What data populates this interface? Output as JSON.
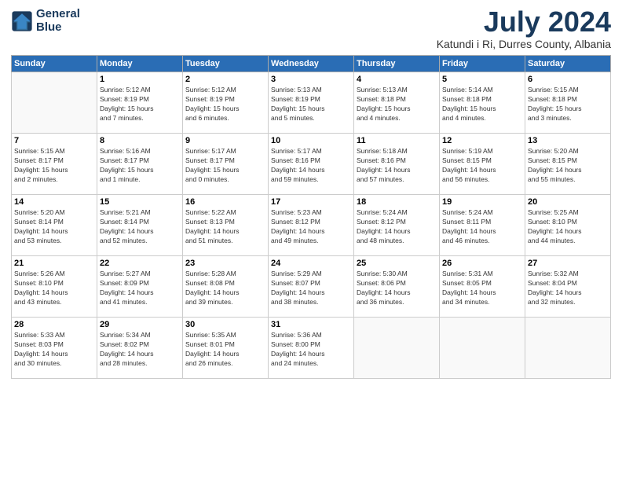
{
  "header": {
    "logo_line1": "General",
    "logo_line2": "Blue",
    "month": "July 2024",
    "location": "Katundi i Ri, Durres County, Albania"
  },
  "weekdays": [
    "Sunday",
    "Monday",
    "Tuesday",
    "Wednesday",
    "Thursday",
    "Friday",
    "Saturday"
  ],
  "weeks": [
    [
      {
        "day": "",
        "info": ""
      },
      {
        "day": "1",
        "info": "Sunrise: 5:12 AM\nSunset: 8:19 PM\nDaylight: 15 hours\nand 7 minutes."
      },
      {
        "day": "2",
        "info": "Sunrise: 5:12 AM\nSunset: 8:19 PM\nDaylight: 15 hours\nand 6 minutes."
      },
      {
        "day": "3",
        "info": "Sunrise: 5:13 AM\nSunset: 8:19 PM\nDaylight: 15 hours\nand 5 minutes."
      },
      {
        "day": "4",
        "info": "Sunrise: 5:13 AM\nSunset: 8:18 PM\nDaylight: 15 hours\nand 4 minutes."
      },
      {
        "day": "5",
        "info": "Sunrise: 5:14 AM\nSunset: 8:18 PM\nDaylight: 15 hours\nand 4 minutes."
      },
      {
        "day": "6",
        "info": "Sunrise: 5:15 AM\nSunset: 8:18 PM\nDaylight: 15 hours\nand 3 minutes."
      }
    ],
    [
      {
        "day": "7",
        "info": "Sunrise: 5:15 AM\nSunset: 8:17 PM\nDaylight: 15 hours\nand 2 minutes."
      },
      {
        "day": "8",
        "info": "Sunrise: 5:16 AM\nSunset: 8:17 PM\nDaylight: 15 hours\nand 1 minute."
      },
      {
        "day": "9",
        "info": "Sunrise: 5:17 AM\nSunset: 8:17 PM\nDaylight: 15 hours\nand 0 minutes."
      },
      {
        "day": "10",
        "info": "Sunrise: 5:17 AM\nSunset: 8:16 PM\nDaylight: 14 hours\nand 59 minutes."
      },
      {
        "day": "11",
        "info": "Sunrise: 5:18 AM\nSunset: 8:16 PM\nDaylight: 14 hours\nand 57 minutes."
      },
      {
        "day": "12",
        "info": "Sunrise: 5:19 AM\nSunset: 8:15 PM\nDaylight: 14 hours\nand 56 minutes."
      },
      {
        "day": "13",
        "info": "Sunrise: 5:20 AM\nSunset: 8:15 PM\nDaylight: 14 hours\nand 55 minutes."
      }
    ],
    [
      {
        "day": "14",
        "info": "Sunrise: 5:20 AM\nSunset: 8:14 PM\nDaylight: 14 hours\nand 53 minutes."
      },
      {
        "day": "15",
        "info": "Sunrise: 5:21 AM\nSunset: 8:14 PM\nDaylight: 14 hours\nand 52 minutes."
      },
      {
        "day": "16",
        "info": "Sunrise: 5:22 AM\nSunset: 8:13 PM\nDaylight: 14 hours\nand 51 minutes."
      },
      {
        "day": "17",
        "info": "Sunrise: 5:23 AM\nSunset: 8:12 PM\nDaylight: 14 hours\nand 49 minutes."
      },
      {
        "day": "18",
        "info": "Sunrise: 5:24 AM\nSunset: 8:12 PM\nDaylight: 14 hours\nand 48 minutes."
      },
      {
        "day": "19",
        "info": "Sunrise: 5:24 AM\nSunset: 8:11 PM\nDaylight: 14 hours\nand 46 minutes."
      },
      {
        "day": "20",
        "info": "Sunrise: 5:25 AM\nSunset: 8:10 PM\nDaylight: 14 hours\nand 44 minutes."
      }
    ],
    [
      {
        "day": "21",
        "info": "Sunrise: 5:26 AM\nSunset: 8:10 PM\nDaylight: 14 hours\nand 43 minutes."
      },
      {
        "day": "22",
        "info": "Sunrise: 5:27 AM\nSunset: 8:09 PM\nDaylight: 14 hours\nand 41 minutes."
      },
      {
        "day": "23",
        "info": "Sunrise: 5:28 AM\nSunset: 8:08 PM\nDaylight: 14 hours\nand 39 minutes."
      },
      {
        "day": "24",
        "info": "Sunrise: 5:29 AM\nSunset: 8:07 PM\nDaylight: 14 hours\nand 38 minutes."
      },
      {
        "day": "25",
        "info": "Sunrise: 5:30 AM\nSunset: 8:06 PM\nDaylight: 14 hours\nand 36 minutes."
      },
      {
        "day": "26",
        "info": "Sunrise: 5:31 AM\nSunset: 8:05 PM\nDaylight: 14 hours\nand 34 minutes."
      },
      {
        "day": "27",
        "info": "Sunrise: 5:32 AM\nSunset: 8:04 PM\nDaylight: 14 hours\nand 32 minutes."
      }
    ],
    [
      {
        "day": "28",
        "info": "Sunrise: 5:33 AM\nSunset: 8:03 PM\nDaylight: 14 hours\nand 30 minutes."
      },
      {
        "day": "29",
        "info": "Sunrise: 5:34 AM\nSunset: 8:02 PM\nDaylight: 14 hours\nand 28 minutes."
      },
      {
        "day": "30",
        "info": "Sunrise: 5:35 AM\nSunset: 8:01 PM\nDaylight: 14 hours\nand 26 minutes."
      },
      {
        "day": "31",
        "info": "Sunrise: 5:36 AM\nSunset: 8:00 PM\nDaylight: 14 hours\nand 24 minutes."
      },
      {
        "day": "",
        "info": ""
      },
      {
        "day": "",
        "info": ""
      },
      {
        "day": "",
        "info": ""
      }
    ]
  ]
}
